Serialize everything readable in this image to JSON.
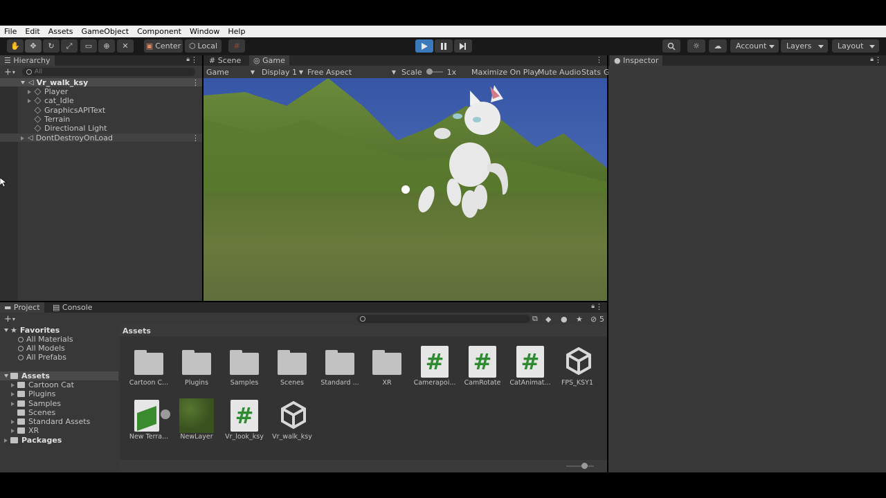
{
  "menu": [
    "File",
    "Edit",
    "Assets",
    "GameObject",
    "Component",
    "Window",
    "Help"
  ],
  "toolbar": {
    "pivot_label": "Center",
    "space_label": "Local",
    "account_label": "Account",
    "layers_label": "Layers",
    "layout_label": "Layout"
  },
  "hierarchy": {
    "tab_label": "Hierarchy",
    "search_placeholder": "All",
    "items": [
      {
        "label": "Vr_walk_ksy"
      },
      {
        "label": "Player"
      },
      {
        "label": "cat_Idle"
      },
      {
        "label": "GraphicsAPIText"
      },
      {
        "label": "Terrain"
      },
      {
        "label": "Directional Light"
      },
      {
        "label": "DontDestroyOnLoad"
      }
    ]
  },
  "view_tabs": {
    "scene": "Scene",
    "game": "Game"
  },
  "game_bar": {
    "mode": "Game",
    "display": "Display 1",
    "aspect": "Free Aspect",
    "scale_label": "Scale",
    "scale_value": "1x",
    "maximize": "Maximize On Play",
    "mute": "Mute Audio",
    "stats": "Stats",
    "gizmos": "G"
  },
  "inspector": {
    "tab_label": "Inspector"
  },
  "bottom_tabs": {
    "project": "Project",
    "console": "Console"
  },
  "project_sidebar": {
    "favorites": "Favorites",
    "favorite_items": [
      "All Materials",
      "All Models",
      "All Prefabs"
    ],
    "assets": "Assets",
    "asset_folders": [
      "Cartoon Cat",
      "Plugins",
      "Samples",
      "Scenes",
      "Standard Assets",
      "XR"
    ],
    "packages": "Packages"
  },
  "project_main": {
    "breadcrumb": "Assets",
    "hidden_count": "5",
    "items": [
      {
        "label": "Cartoon C...",
        "kind": "folder"
      },
      {
        "label": "Plugins",
        "kind": "folder"
      },
      {
        "label": "Samples",
        "kind": "folder"
      },
      {
        "label": "Scenes",
        "kind": "folder"
      },
      {
        "label": "Standard ...",
        "kind": "folder"
      },
      {
        "label": "XR",
        "kind": "folder"
      },
      {
        "label": "Camerapoi...",
        "kind": "script"
      },
      {
        "label": "CamRotate",
        "kind": "script"
      },
      {
        "label": "CatAnimat...",
        "kind": "script"
      },
      {
        "label": "FPS_KSY1",
        "kind": "scene"
      },
      {
        "label": "New Terra...",
        "kind": "terrain"
      },
      {
        "label": "NewLayer",
        "kind": "layer"
      },
      {
        "label": "Vr_look_ksy",
        "kind": "script"
      },
      {
        "label": "Vr_walk_ksy",
        "kind": "scene"
      }
    ],
    "script_glyph": "#"
  },
  "colors": {
    "accent": "#3a79bb",
    "panel": "#383838",
    "sky": "#3b5aa8",
    "ground": "#5f7a3a"
  }
}
